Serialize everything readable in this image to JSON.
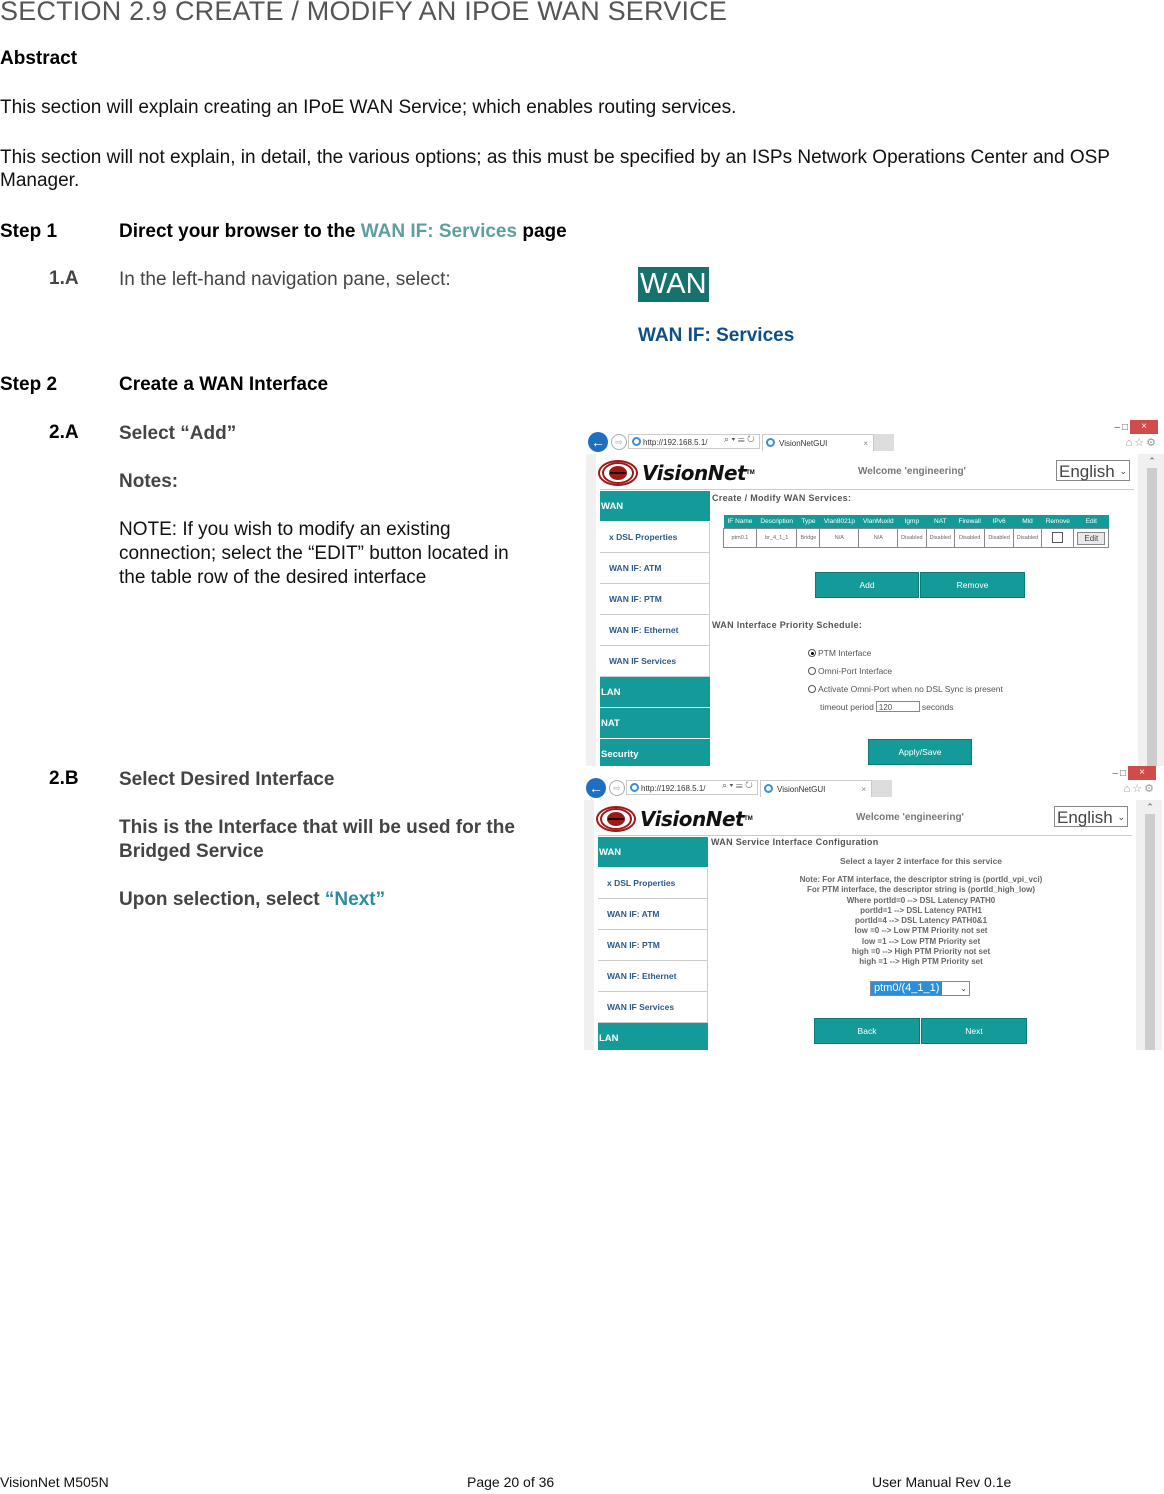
{
  "section_title": "SECTION 2.9  CREATE / MODIFY AN IPOE WAN SERVICE",
  "abstract": {
    "heading": "Abstract",
    "para1": "This section will explain creating an IPoE WAN Service;  which enables routing services.",
    "para2": "This section will not explain, in detail, the various options; as this must be specified by an ISPs Network Operations Center and OSP Manager."
  },
  "step1": {
    "label": "Step 1",
    "title_prefix": "Direct your browser to the ",
    "title_link": "WAN IF: Services",
    "title_suffix": " page",
    "sub_1a": {
      "num": "1.A",
      "text": "In the left-hand navigation pane, select:",
      "badge": "WAN",
      "link": "WAN IF: Services"
    }
  },
  "step2": {
    "label": "Step 2",
    "title": "Create a WAN Interface",
    "sub_2a": {
      "num": "2.A",
      "title": "Select “Add”",
      "notes_label": "Notes:",
      "note": "NOTE: If you wish to modify an existing connection; select the “EDIT” button located in the table row of the desired interface"
    },
    "sub_2b": {
      "num": "2.B",
      "title": "Select Desired Interface",
      "desc": "This is the Interface that will be used for the Bridged Service",
      "instr_prefix": "Upon selection, select ",
      "instr_link": "“Next”"
    }
  },
  "browser": {
    "url": "http://192.168.5.1/",
    "tab_title": "VisionNetGUI",
    "minimize": "–",
    "maximize": "□",
    "close": "×",
    "back_icon": "←",
    "forward_icon": "⇨",
    "addr_tools": "⌕ ▾ ☰ ↻",
    "toolbar_icons": "⌂☆⚙",
    "logo_text": "VisionNet",
    "logo_tm": "TM",
    "welcome": "Welcome 'engineering'",
    "language": "English"
  },
  "shot1": {
    "nav": [
      {
        "label": "WAN",
        "main": true
      },
      {
        "label": "x DSL Properties",
        "main": false
      },
      {
        "label": "WAN IF: ATM",
        "main": false
      },
      {
        "label": "WAN IF: PTM",
        "main": false
      },
      {
        "label": "WAN IF: Ethernet",
        "main": false
      },
      {
        "label": "WAN IF Services",
        "main": false
      },
      {
        "label": "LAN",
        "main": true
      },
      {
        "label": "NAT",
        "main": true
      },
      {
        "label": "Security",
        "main": true
      }
    ],
    "title": "Create / Modify WAN Services:",
    "table": {
      "headers": [
        "IF Name",
        "Description",
        "Type",
        "Vlan8021p",
        "VlanMuxId",
        "Igmp",
        "NAT",
        "Firewall",
        "IPv6",
        "Mld",
        "Remove",
        "Edit"
      ],
      "rows": [
        [
          "ptm0.1",
          "br_4_1_1",
          "Bridge",
          "N/A",
          "N/A",
          "Disabled",
          "Disabled",
          "Disabled",
          "Disabled",
          "Disabled",
          "",
          "Edit"
        ]
      ]
    },
    "add_button": "Add",
    "remove_button": "Remove",
    "priority_title": "WAN Interface Priority Schedule:",
    "radios": [
      {
        "label": "PTM Interface",
        "selected": true
      },
      {
        "label": "Omni-Port Interface",
        "selected": false
      },
      {
        "label": "Activate Omni-Port when no DSL Sync is present",
        "selected": false
      }
    ],
    "timeout_prefix": "timeout period",
    "timeout_value": "120",
    "timeout_suffix": "seconds",
    "apply_button": "Apply/Save"
  },
  "shot2": {
    "nav": [
      {
        "label": "WAN",
        "main": true
      },
      {
        "label": "x DSL Properties",
        "main": false
      },
      {
        "label": "WAN IF: ATM",
        "main": false
      },
      {
        "label": "WAN IF: PTM",
        "main": false
      },
      {
        "label": "WAN IF: Ethernet",
        "main": false
      },
      {
        "label": "WAN IF Services",
        "main": false
      },
      {
        "label": "LAN",
        "main": true
      }
    ],
    "title": "WAN Service Interface Configuration",
    "subtitle": "Select a layer 2 interface for this service",
    "notes": [
      "Note: For ATM interface, the descriptor string is (portId_vpi_vci)",
      "For PTM interface, the descriptor string is (portId_high_low)",
      "Where portId=0 --> DSL Latency PATH0",
      "portId=1 --> DSL Latency PATH1",
      "portId=4 --> DSL Latency PATH0&1",
      "low =0 --> Low PTM Priority not set",
      "low =1 --> Low PTM Priority set",
      "high =0 --> High PTM Priority not set",
      "high =1 --> High PTM Priority set"
    ],
    "selected_interface": "ptm0/(4_1_1)",
    "back_button": "Back",
    "next_button": "Next"
  },
  "footer": {
    "left": "VisionNet   M505N",
    "center": "Page 20 of 36",
    "right": "User Manual Rev 0.1e"
  },
  "colors": {
    "teal": "#149b99",
    "badge": "#17716d",
    "link_blue": "#0e4f8a",
    "step_link": "#5f9ea0",
    "close_red": "#d14b4b",
    "select_blue": "#2a8fd8"
  }
}
